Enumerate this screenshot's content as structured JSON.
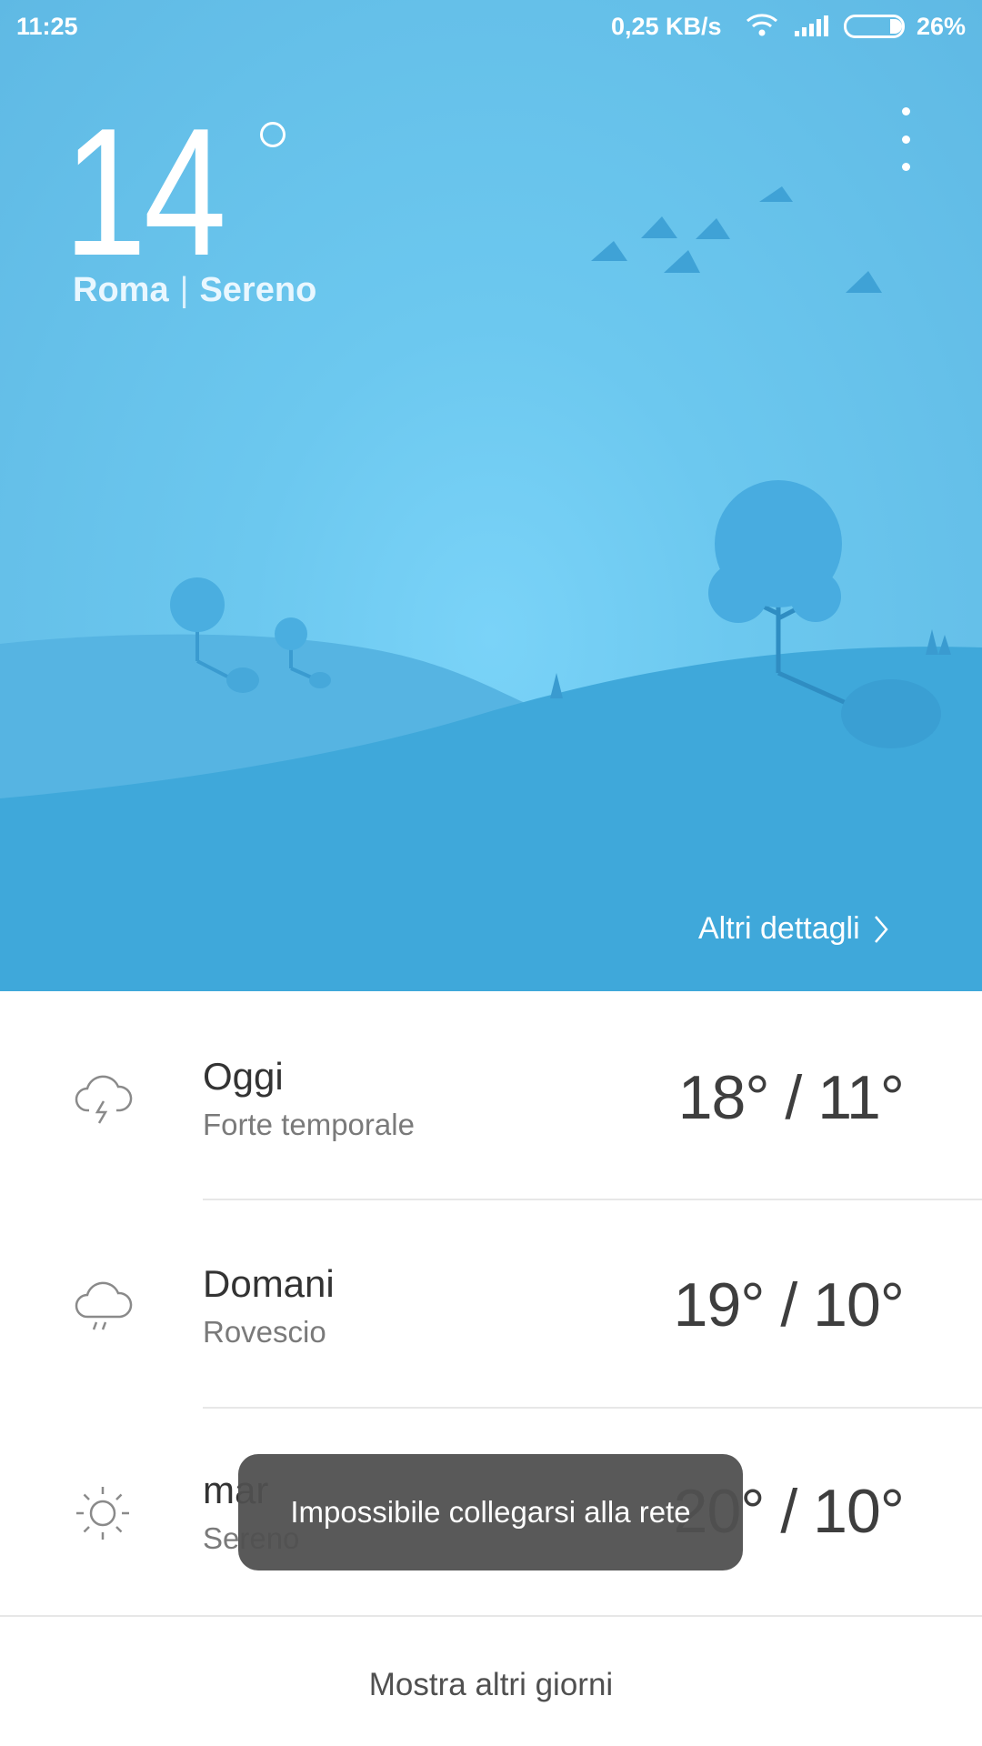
{
  "status_bar": {
    "time": "11:25",
    "net_speed": "0,25 KB/s",
    "battery_percent": "26%",
    "battery_level": 0.26,
    "icons": [
      "wifi-icon",
      "signal-icon",
      "battery-icon"
    ]
  },
  "current": {
    "temperature": "14",
    "city": "Roma",
    "separator": "|",
    "condition": "Sereno"
  },
  "header": {
    "more_icon": "more-vertical-icon",
    "details_link": "Altri dettagli"
  },
  "forecast": [
    {
      "day": "Oggi",
      "condition": "Forte temporale",
      "temps": "18° / 11°",
      "icon": "thunderstorm-icon"
    },
    {
      "day": "Domani",
      "condition": "Rovescio",
      "temps": "19° / 10°",
      "icon": "rain-icon"
    },
    {
      "day": "mar",
      "condition": "Sereno",
      "temps": "20° / 10°",
      "icon": "sun-icon"
    }
  ],
  "more_days_label": "Mostra altri giorni",
  "toast": "Impossibile collegarsi alla rete",
  "colors": {
    "sky": "#66c2ec",
    "hill_back": "#55b3e2",
    "hill_front": "#3fa6d8",
    "text_dark": "#333333"
  }
}
